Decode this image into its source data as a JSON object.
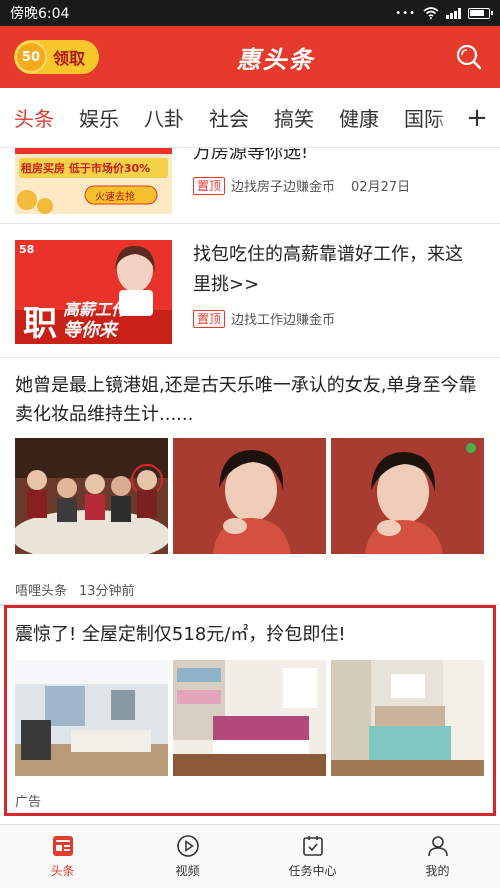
{
  "status_bar": {
    "time": "傍晚6:04"
  },
  "header": {
    "coins": "50",
    "claim_label": "领取",
    "title": "惠头条"
  },
  "tabs": [
    "头条",
    "娱乐",
    "八卦",
    "社会",
    "搞笑",
    "健康",
    "国际"
  ],
  "tab_more": "+",
  "feed": {
    "item1": {
      "title": "万房源等你选!",
      "banner_line1": "租房买房 低于市场价30%",
      "banner_button": "火速去抢",
      "badge": "置顶",
      "source": "边找房子边赚金币",
      "date": "02月27日"
    },
    "item2": {
      "title": "找包吃住的高薪靠谱好工作，来这里挑>>",
      "banner_badge": "58",
      "banner_big": "职",
      "banner_text1": "高薪工作",
      "banner_text2": "等你来",
      "badge": "置顶",
      "source": "边找工作边赚金币"
    },
    "item3": {
      "title": "她曾是最上镜港姐,还是古天乐唯一承认的女友,单身至今靠卖化妆品维持生计......",
      "source": "唔哩头条",
      "time": "13分钟前"
    },
    "ad": {
      "title": "震惊了! 全屋定制仅518元/㎡，拎包即住!",
      "label": "广告"
    }
  },
  "bottom_nav": [
    {
      "label": "头条",
      "icon": "news-icon"
    },
    {
      "label": "视频",
      "icon": "play-icon"
    },
    {
      "label": "任务中心",
      "icon": "calendar-check-icon"
    },
    {
      "label": "我的",
      "icon": "user-icon"
    }
  ],
  "colors": {
    "brand_red": "#e53a2c",
    "coin_yellow": "#f7c72b",
    "ad_border": "#d9262b"
  }
}
